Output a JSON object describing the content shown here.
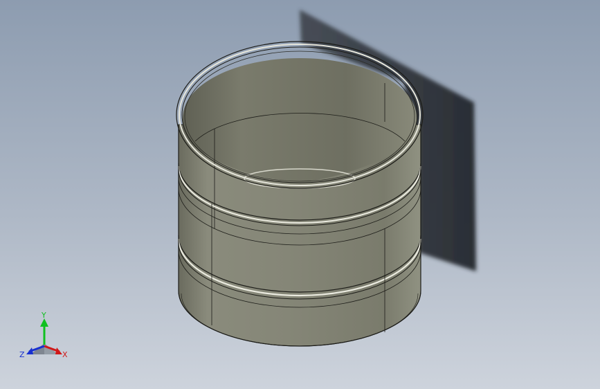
{
  "viewport": {
    "background_top": "#8d9cb0",
    "background_bottom": "#cdd3dc"
  },
  "model": {
    "shape": "cylindrical sleeve with grooves",
    "body_color": "#7e7e6e",
    "interior_color": "#6f7062",
    "shadow_color": "#2b2f36"
  },
  "triad": {
    "x_label": "X",
    "y_label": "Y",
    "z_label": "Z",
    "x_color": "#d01818",
    "y_color": "#10c020",
    "z_color": "#1830d0"
  }
}
